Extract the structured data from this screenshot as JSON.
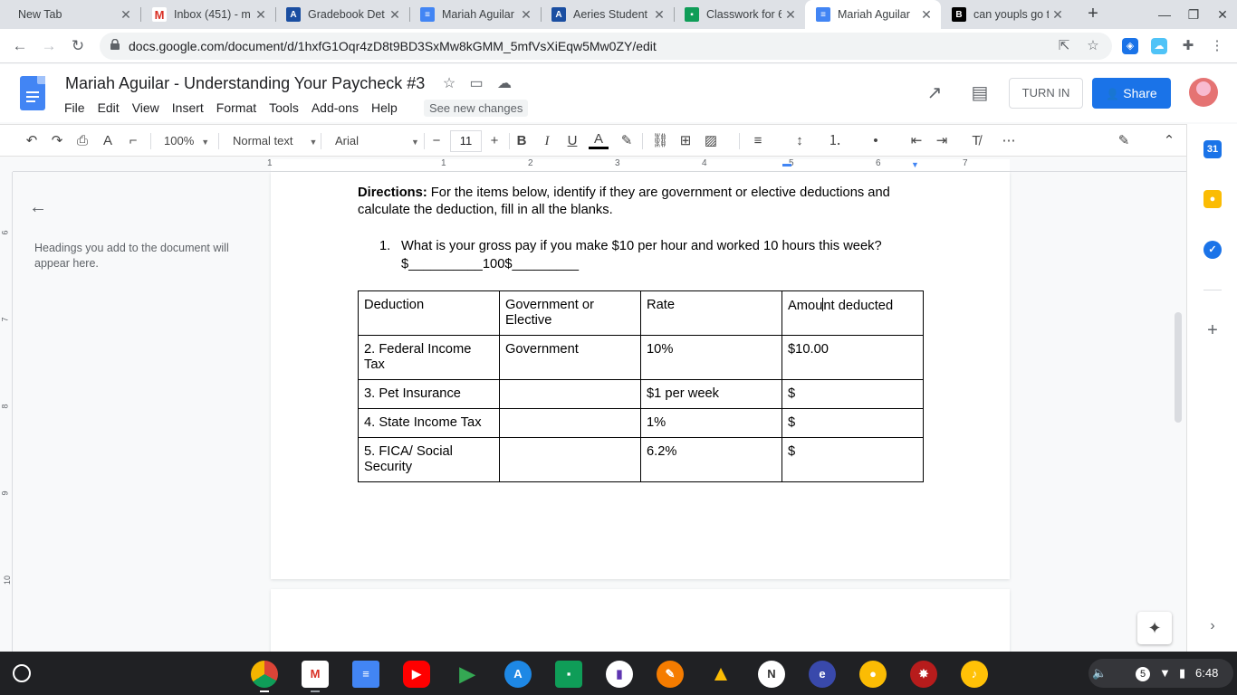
{
  "tabs": [
    {
      "title": "New Tab",
      "icon": "none"
    },
    {
      "title": "Inbox (451) - m",
      "icon": "gmail-icon"
    },
    {
      "title": "Gradebook Det",
      "icon": "aeries-icon"
    },
    {
      "title": "Mariah Aguilar",
      "icon": "docs-icon"
    },
    {
      "title": "Aeries Student",
      "icon": "aeries-icon"
    },
    {
      "title": "Classwork for 6",
      "icon": "classroom-icon"
    },
    {
      "title": "Mariah Aguilar",
      "icon": "docs-icon"
    },
    {
      "title": "can youpls go t",
      "icon": "brainly-icon"
    }
  ],
  "omnibox": {
    "url": "docs.google.com/document/d/1hxfG1Oqr4zD8t9BD3SxMw8kGMM_5mfVsXiEqw5Mw0ZY/edit"
  },
  "doc": {
    "title": "Mariah Aguilar - Understanding Your Paycheck #3",
    "menu": [
      "File",
      "Edit",
      "View",
      "Insert",
      "Format",
      "Tools",
      "Add-ons",
      "Help"
    ],
    "see_new_changes": "See new changes",
    "turn_in": "TURN IN",
    "share": "Share"
  },
  "format_toolbar": {
    "zoom": "100%",
    "style": "Normal text",
    "font": "Arial",
    "font_size": "11"
  },
  "ruler": {
    "numbers": [
      "1",
      "1",
      "2",
      "3",
      "4",
      "5",
      "6",
      "7"
    ],
    "vertical": [
      "6",
      "7",
      "8",
      "9",
      "10"
    ]
  },
  "outline": {
    "empty_text": "Headings you add to the document will appear here."
  },
  "content": {
    "directions_label": "Directions:",
    "directions_text": " For the items below, identify if they are government or elective deductions and calculate the deduction, fill in all the blanks.",
    "q1_number": "1.",
    "q1_text": "What is your gross pay if you make $10 per hour and worked 10 hours this week?",
    "q1_answer": "$__________100$_________"
  },
  "table": {
    "headers": [
      "Deduction",
      "Government or Elective",
      "Rate",
      "Amount deducted"
    ],
    "header_amount_before_cursor": "Amou",
    "header_amount_after_cursor": "nt deducted",
    "rows": [
      [
        "2. Federal Income Tax",
        "Government",
        "10%",
        "$10.00"
      ],
      [
        "3. Pet Insurance",
        "",
        "$1 per week",
        "$"
      ],
      [
        "4. State Income Tax",
        "",
        "1%",
        "$"
      ],
      [
        "5. FICA/ Social Security",
        "",
        "6.2%",
        "$"
      ]
    ]
  },
  "shelf": {
    "status_count": "5",
    "time": "6:48"
  },
  "colors": {
    "accent": "#1a73e8",
    "docs_blue": "#4285f4",
    "shelf": "#202124"
  }
}
